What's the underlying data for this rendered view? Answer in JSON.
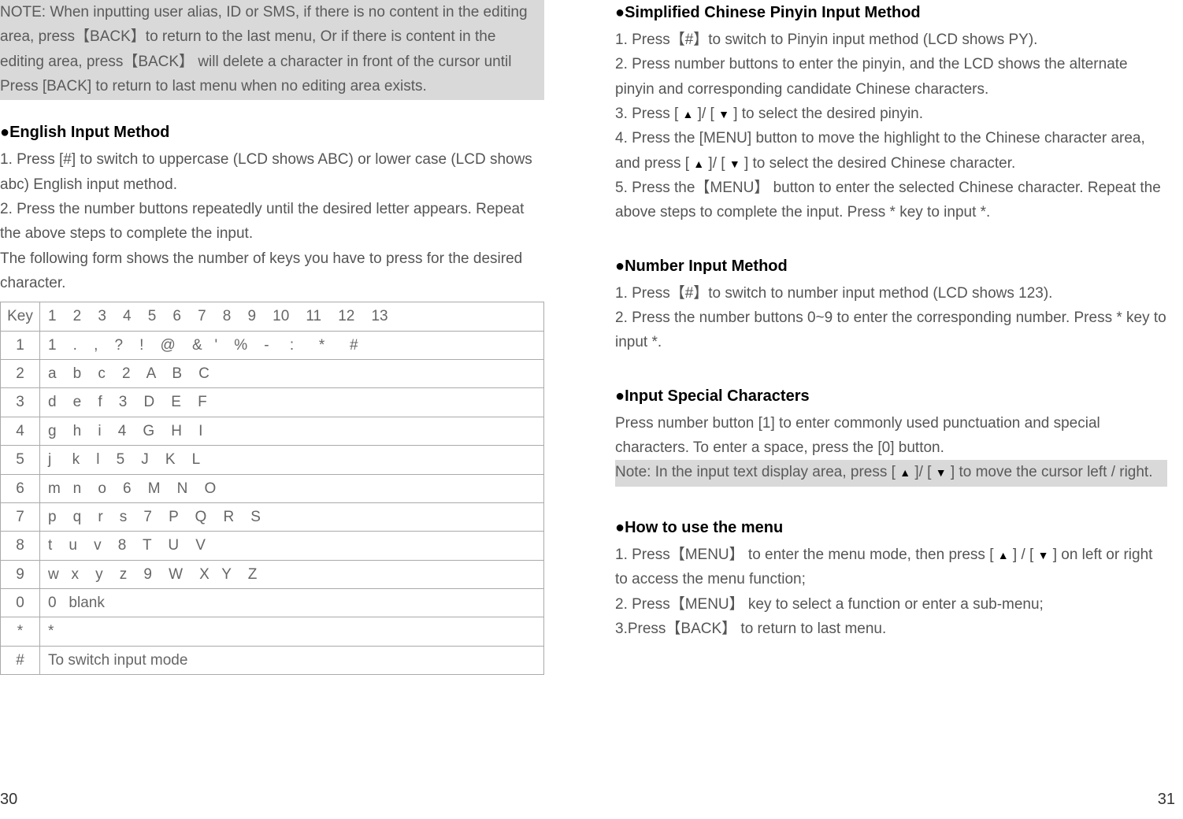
{
  "left": {
    "note": "NOTE: When inputting user alias, ID or SMS, if there is no content in the editing area, press【BACK】to return to the last menu, Or if there is content in the editing area, press【BACK】 will delete a character in front of the cursor until Press [BACK] to return to last menu when no editing area exists.",
    "heading1": "●English Input Method",
    "p1": "1. Press [#] to switch to uppercase (LCD shows ABC) or lower case (LCD shows abc) English input method.",
    "p2": "2. Press the number buttons repeatedly until the desired letter appears. Repeat the above steps to complete the input.",
    "p3": "The following form shows the number of keys you have to press for the desired character.",
    "table_header_label": "Key",
    "table_header_nums": "1    2    3    4    5    6    7    8    9    10    11    12    13",
    "rows": [
      {
        "k": "1",
        "v": "1    .    ,    ?    !    @    &   '    %    -     :      *      #"
      },
      {
        "k": "2",
        "v": "a    b    c    2    A    B    C"
      },
      {
        "k": "3",
        "v": "d    e    f    3    D    E    F"
      },
      {
        "k": "4",
        "v": "g    h    i    4    G    H    I"
      },
      {
        "k": "5",
        "v": "j     k    l    5    J    K    L"
      },
      {
        "k": "6",
        "v": "m   n    o    6    M    N    O"
      },
      {
        "k": "7",
        "v": "p    q    r    s    7    P    Q    R    S"
      },
      {
        "k": "8",
        "v": "t    u    v    8    T    U    V"
      },
      {
        "k": "9",
        "v": "w   x    y    z    9    W    X   Y    Z"
      },
      {
        "k": "0",
        "v": "0   blank"
      },
      {
        "k": "*",
        "v": "*"
      },
      {
        "k": "#",
        "v": "To switch input mode"
      }
    ],
    "page_num": "30"
  },
  "right": {
    "heading1": "●Simplified Chinese Pinyin Input Method",
    "h1p1": "1. Press【#】to switch to Pinyin input method (LCD shows PY).",
    "h1p2": "2. Press number buttons to enter the pinyin, and the LCD shows the alternate pinyin and corresponding candidate Chinese characters.",
    "h1p3a": "3. Press [ ",
    "h1p3b": " ]/ [ ",
    "h1p3c": " ] to select the desired pinyin.",
    "h1p4a": "4. Press the [MENU] button to move the highlight to the Chinese character area, and press [ ",
    "h1p4b": " ]/ [ ",
    "h1p4c": " ] to select the desired Chinese character.",
    "h1p5": "5. Press the【MENU】 button to enter the selected Chinese character. Repeat the above steps to complete the input. Press * key to input *.",
    "heading2": "●Number Input Method",
    "h2p1": "1. Press【#】to switch to number input method (LCD shows 123).",
    "h2p2": "2. Press the number buttons 0~9 to enter the corresponding number. Press * key to input *.",
    "heading3": "●Input Special Characters",
    "h3p1": "Press number button [1] to enter commonly used punctuation and special characters. To enter a space, press the [0] button.",
    "h3notea": "Note: In the input text display area, press [ ",
    "h3noteb": " ]/ [ ",
    "h3notec": " ] to move the cursor left / right.",
    "heading4": "●How to use the menu",
    "h4p1a": "1. Press【MENU】 to enter the menu mode, then press [ ",
    "h4p1b": " ] / [ ",
    "h4p1c": " ] on left or right to access the menu function;",
    "h4p2": " 2. Press【MENU】 key to select a function or enter a sub-menu;",
    "h4p3": "3.Press【BACK】 to return to last menu.",
    "page_num": "31"
  }
}
